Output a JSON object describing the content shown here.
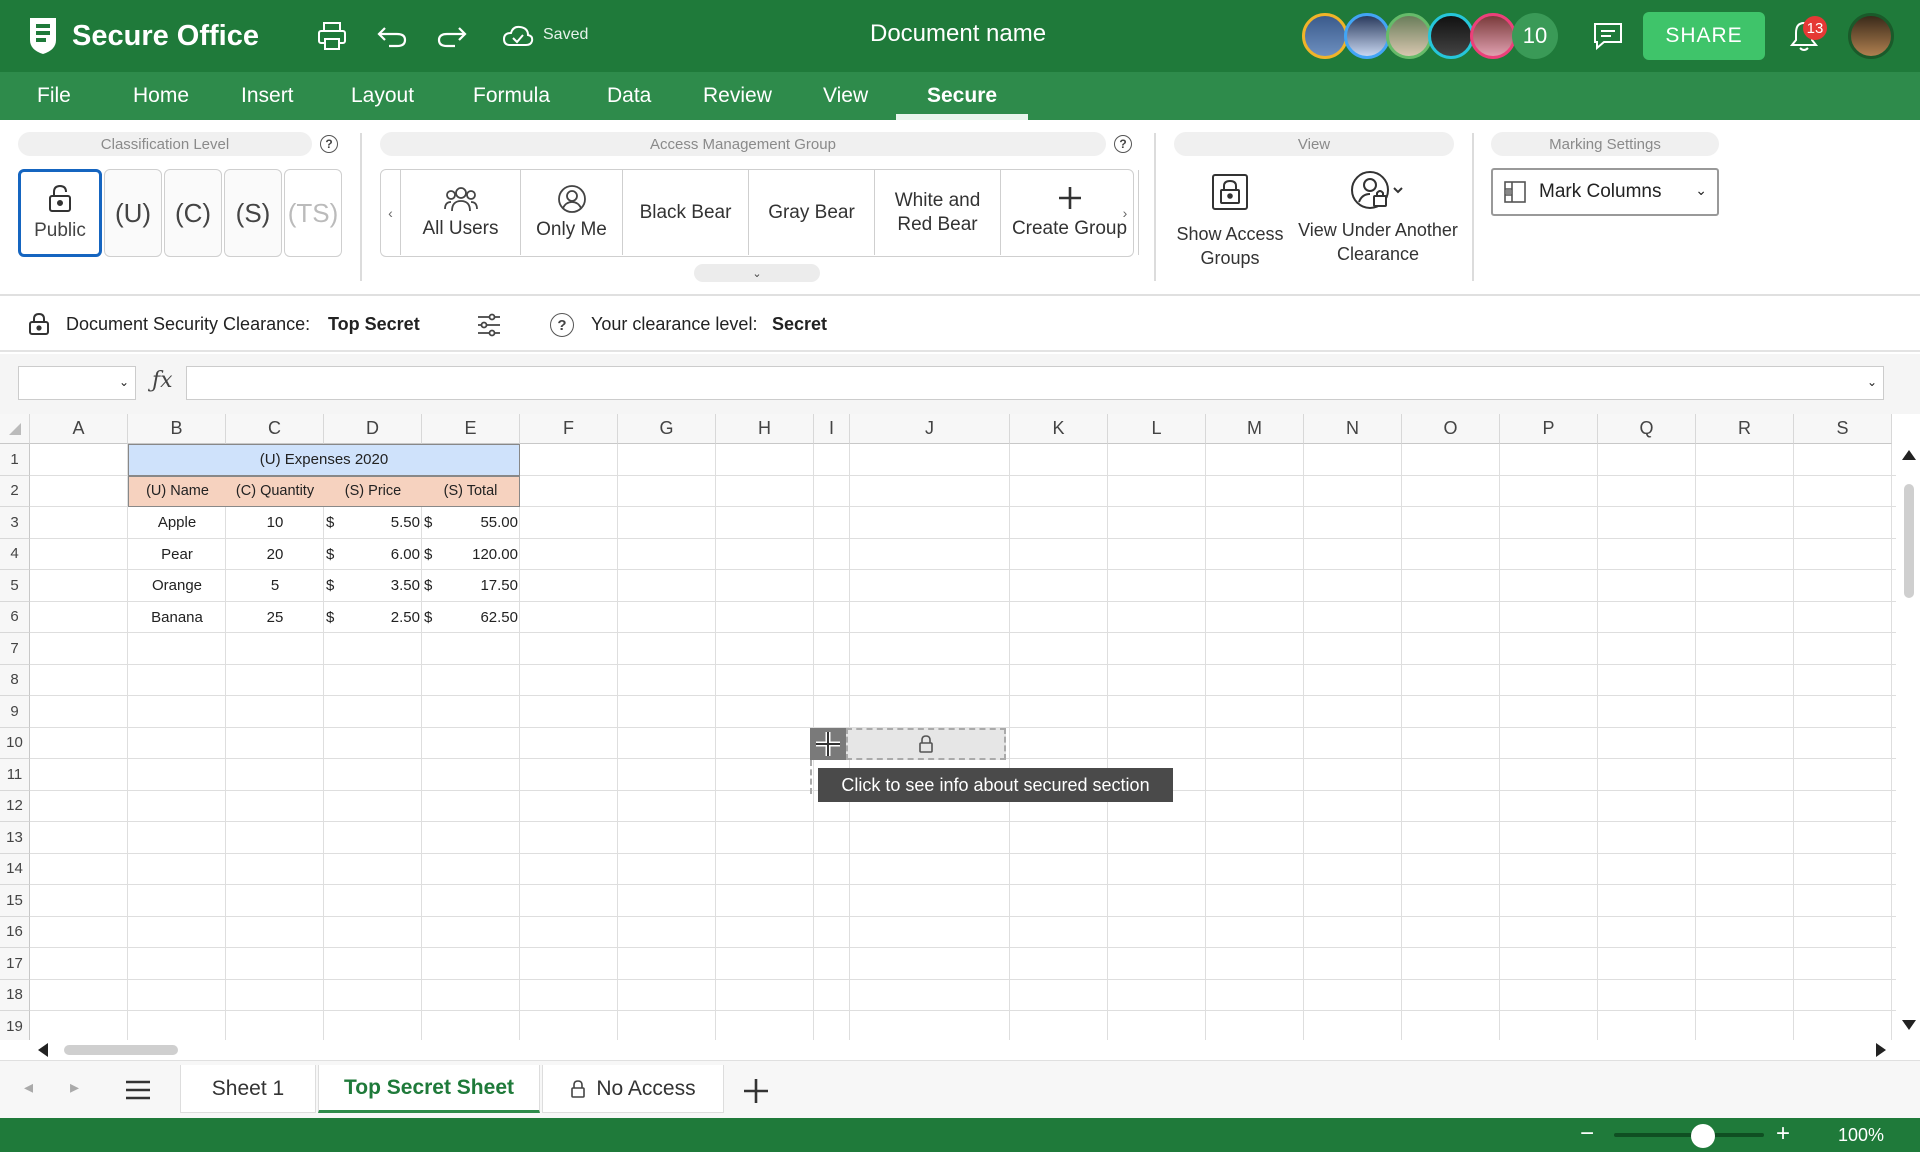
{
  "app": {
    "name": "Secure Office",
    "saved_label": "Saved",
    "document_name": "Document name"
  },
  "header": {
    "collaborators_more": "10",
    "share_label": "SHARE",
    "notifications_count": "13"
  },
  "menu": {
    "items": [
      "File",
      "Home",
      "Insert",
      "Layout",
      "Formula",
      "Data",
      "Review",
      "View",
      "Secure"
    ],
    "active": "Secure"
  },
  "ribbon": {
    "classification": {
      "label": "Classification Level",
      "buttons": [
        "Public",
        "(U)",
        "(C)",
        "(S)",
        "(TS)"
      ],
      "active": "Public"
    },
    "access": {
      "label": "Access Management Group",
      "buttons": [
        "All Users",
        "Only Me",
        "Black Bear",
        "Gray Bear",
        "White and Red Bear",
        "Create Group"
      ]
    },
    "view": {
      "label": "View",
      "show_access": "Show Access Groups",
      "view_under": "View Under Another Clearance"
    },
    "marking": {
      "label": "Marking Settings",
      "select_value": "Mark Columns"
    }
  },
  "security_bar": {
    "doc_label": "Document Security Clearance:",
    "doc_value": "Top Secret",
    "user_label": "Your clearance level:",
    "user_value": "Secret"
  },
  "sheet": {
    "columns": [
      "A",
      "B",
      "C",
      "D",
      "E",
      "F",
      "G",
      "H",
      "I",
      "J",
      "K",
      "L",
      "M",
      "N",
      "O",
      "P",
      "Q",
      "R",
      "S"
    ],
    "rows": [
      "1",
      "2",
      "3",
      "4",
      "5",
      "6",
      "7",
      "8",
      "9",
      "10",
      "11",
      "12",
      "13",
      "14",
      "15",
      "16",
      "17",
      "18",
      "19"
    ],
    "table_title": "(U) Expenses 2020",
    "table_headers": [
      "(U) Name",
      "(C) Quantity",
      "(S) Price",
      "(S) Total"
    ],
    "table_rows": [
      {
        "name": "Apple",
        "qty": "10",
        "cur1": "$",
        "price": "5.50",
        "cur2": "$",
        "total": "55.00"
      },
      {
        "name": "Pear",
        "qty": "20",
        "cur1": "$",
        "price": "6.00",
        "cur2": "$",
        "total": "120.00"
      },
      {
        "name": "Orange",
        "qty": "5",
        "cur1": "$",
        "price": "3.50",
        "cur2": "$",
        "total": "17.50"
      },
      {
        "name": "Banana",
        "qty": "25",
        "cur1": "$",
        "price": "2.50",
        "cur2": "$",
        "total": "62.50"
      }
    ],
    "tooltip": "Click to see info about secured section"
  },
  "tabs": {
    "items": [
      "Sheet 1",
      "Top Secret Sheet",
      "No Access"
    ],
    "active": "Top Secret Sheet"
  },
  "status": {
    "zoom": "100%",
    "zoom_fraction": 0.5
  },
  "colors": {
    "brand": "#1f7a3a",
    "menu": "#2e8b4b",
    "share": "#3fc46a",
    "title_fill": "#cfe2fb",
    "header_fill": "#f6d2bf",
    "active_blue": "#1565c0"
  }
}
